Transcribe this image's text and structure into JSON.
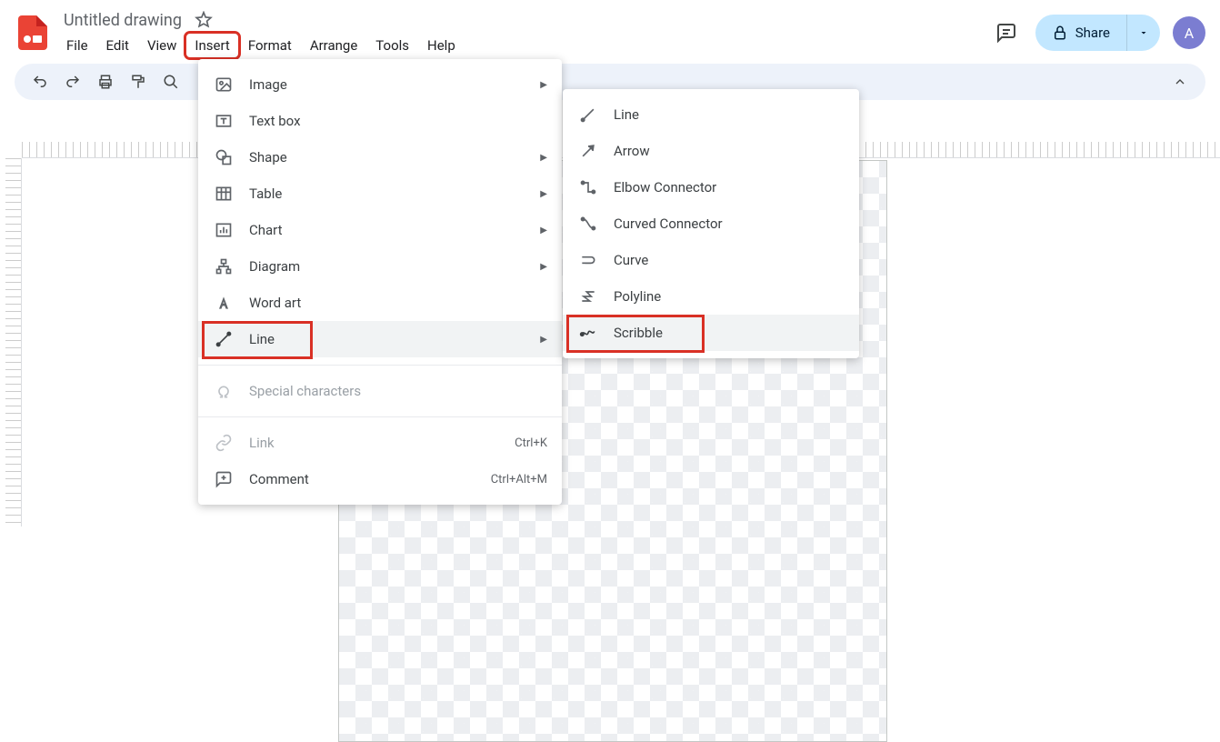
{
  "doc": {
    "title": "Untitled drawing"
  },
  "menus": {
    "file": "File",
    "edit": "Edit",
    "view": "View",
    "insert": "Insert",
    "format": "Format",
    "arrange": "Arrange",
    "tools": "Tools",
    "help": "Help"
  },
  "header": {
    "share": "Share",
    "avatar": "A"
  },
  "insert_menu": {
    "image": "Image",
    "text_box": "Text box",
    "shape": "Shape",
    "table": "Table",
    "chart": "Chart",
    "diagram": "Diagram",
    "word_art": "Word art",
    "line": "Line",
    "special": "Special characters",
    "link": "Link",
    "link_sc": "Ctrl+K",
    "comment": "Comment",
    "comment_sc": "Ctrl+Alt+M"
  },
  "line_submenu": {
    "line": "Line",
    "arrow": "Arrow",
    "elbow": "Elbow Connector",
    "curved": "Curved Connector",
    "curve": "Curve",
    "polyline": "Polyline",
    "scribble": "Scribble"
  }
}
